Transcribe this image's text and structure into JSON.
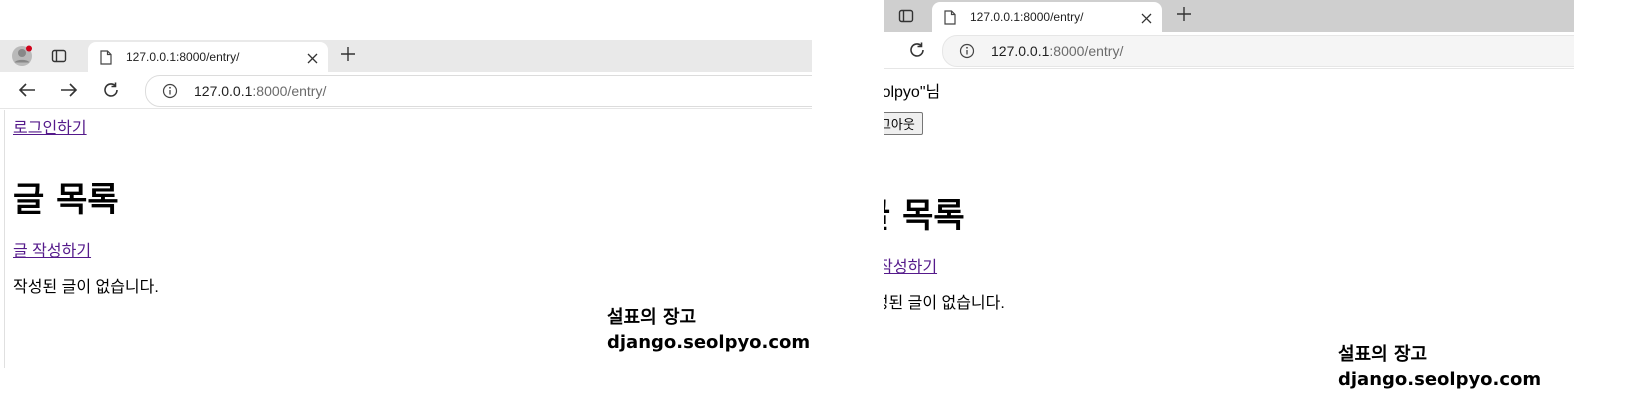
{
  "left_window": {
    "tab": {
      "title": "127.0.0.1:8000/entry/"
    },
    "address": {
      "host": "127.0.0.1",
      "path": ":8000/entry/"
    },
    "page": {
      "login_link": "로그인하기",
      "heading": "글 목록",
      "write_link": "글 작성하기",
      "empty_message": "작성된 글이 없습니다."
    }
  },
  "right_window": {
    "tab": {
      "title": "127.0.0.1:8000/entry/"
    },
    "address": {
      "host": "127.0.0.1",
      "path": ":8000/entry/"
    },
    "page": {
      "user_greeting": "\"seolpyo\"님",
      "logout_button": "로그아웃",
      "heading": "글 목록",
      "write_link": "글 작성하기",
      "empty_message": "작성된 글이 없습니다."
    }
  },
  "watermark": {
    "line1": "설표의 장고",
    "line2": "django.seolpyo.com"
  },
  "colors": {
    "link": "#551a8b",
    "tabbar_left": "#e9e9e9",
    "tabbar_right": "#cfcfcf",
    "profile_badge": "#d0021b"
  },
  "icons": [
    "profile-icon",
    "tab-actions-icon",
    "page-icon",
    "close-icon",
    "plus-icon",
    "back-icon",
    "forward-icon",
    "reload-icon",
    "info-icon"
  ]
}
